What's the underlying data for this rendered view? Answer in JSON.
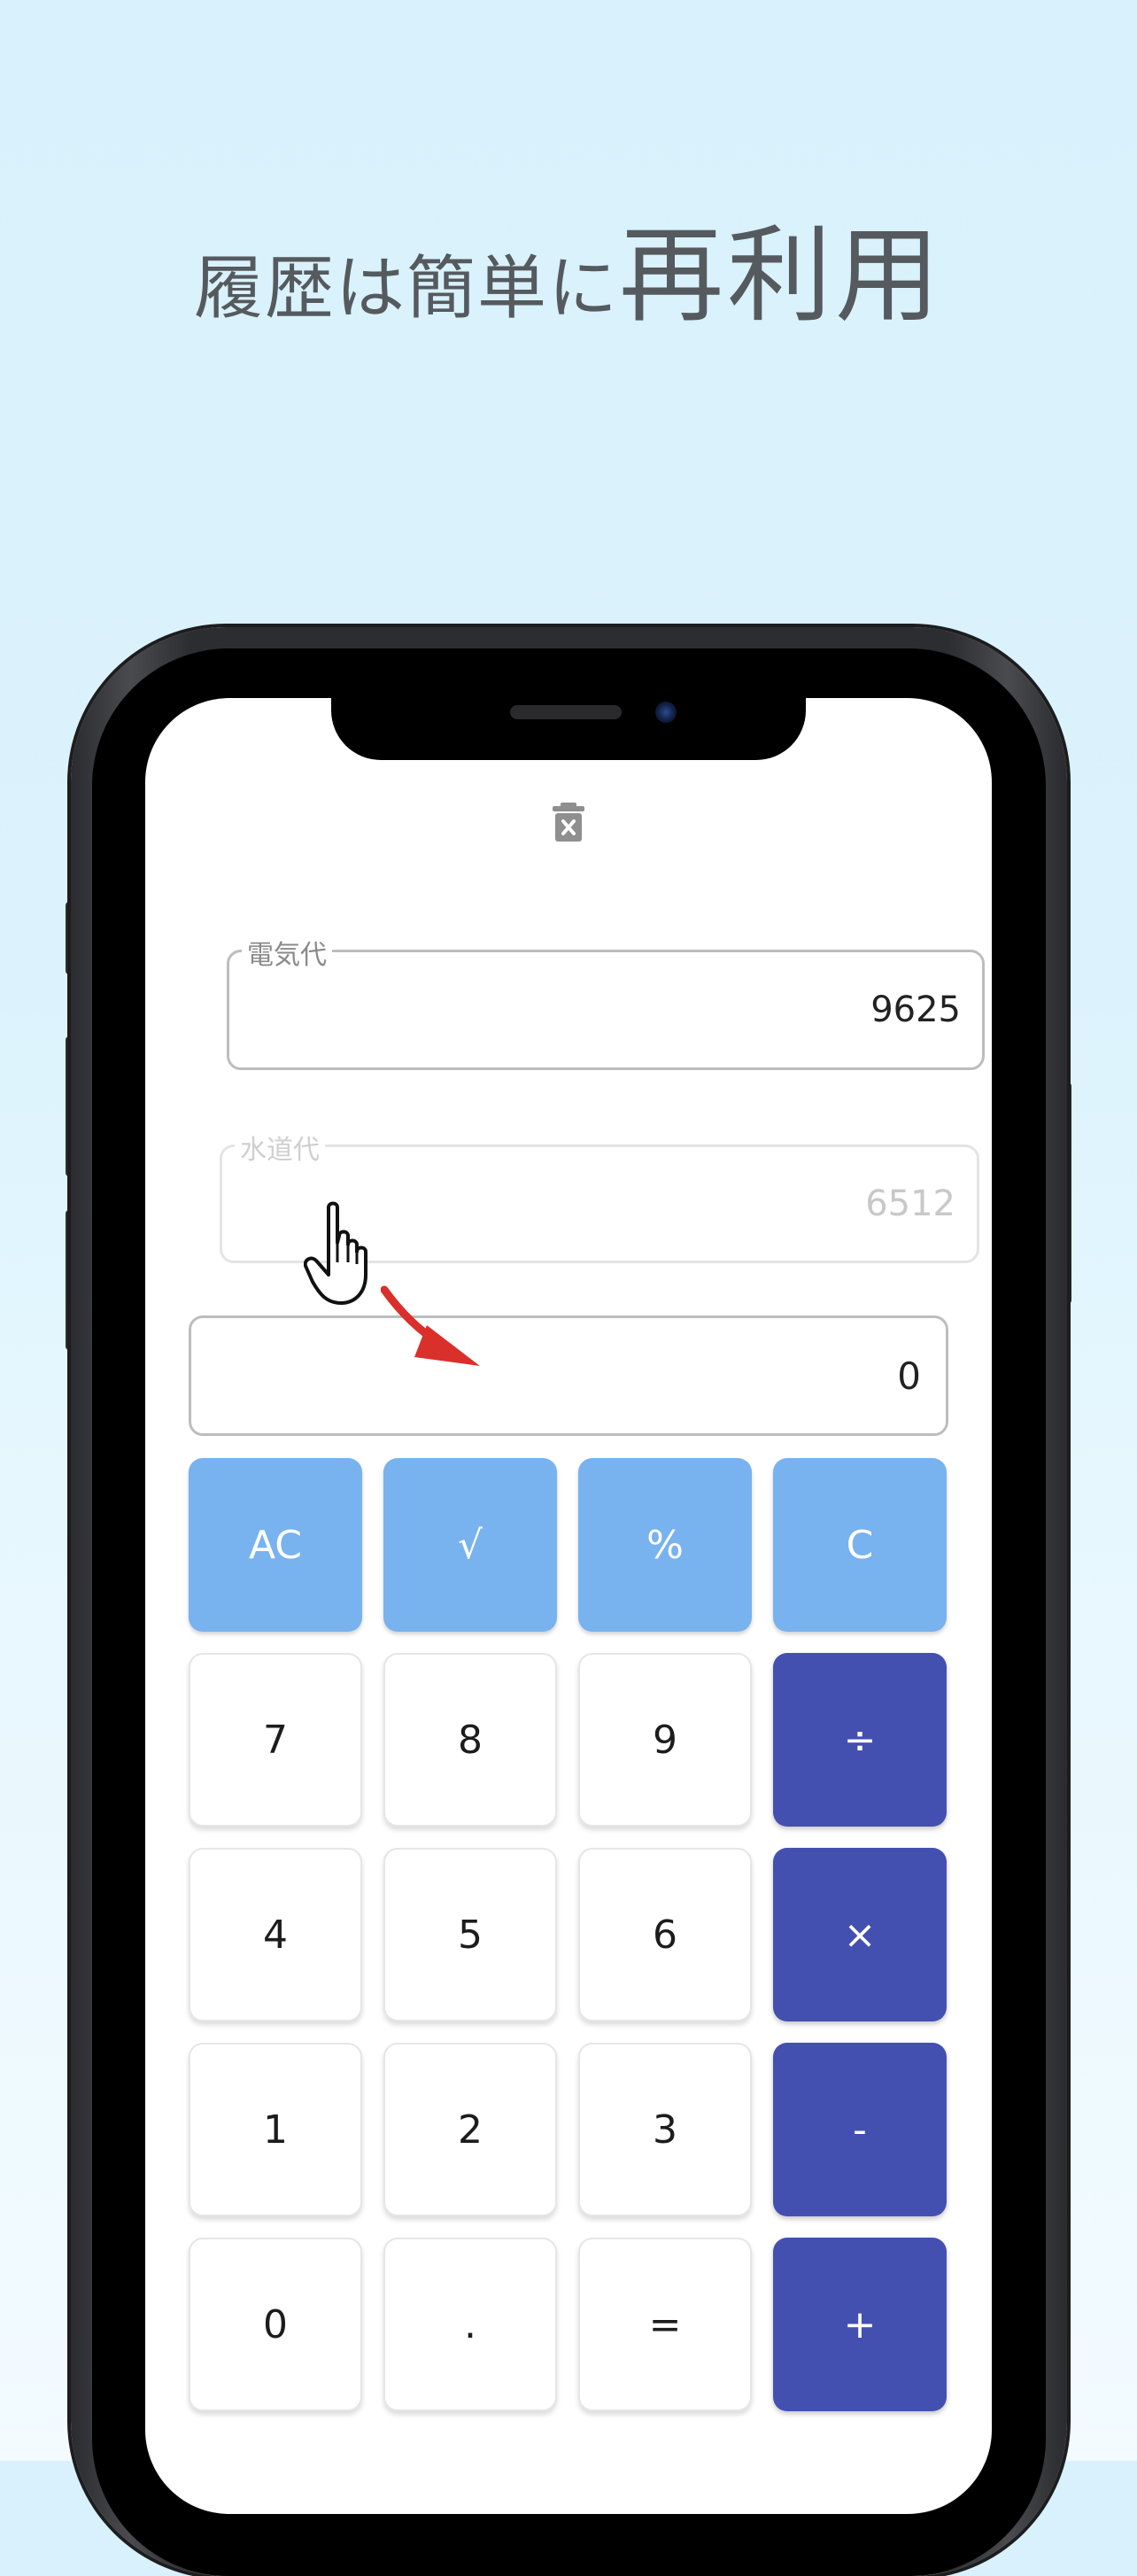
{
  "headline": {
    "prefix": "履歴は簡単に",
    "emphasis": "再利用"
  },
  "toolbar": {
    "clear_history_icon": "trash-x-icon"
  },
  "history": [
    {
      "label": "電気代",
      "value": "9625"
    },
    {
      "label": "水道代",
      "value": "6512"
    }
  ],
  "display": {
    "value": "0"
  },
  "keypad": {
    "rows": [
      [
        "AC",
        "√",
        "%",
        "C"
      ],
      [
        "7",
        "8",
        "9",
        "÷"
      ],
      [
        "4",
        "5",
        "6",
        "×"
      ],
      [
        "1",
        "2",
        "3",
        "-"
      ],
      [
        "0",
        ".",
        "=",
        "+"
      ]
    ]
  },
  "colors": {
    "function_key": "#78b2ef",
    "operator_key": "#4450b0",
    "arrow": "#d9302c"
  }
}
